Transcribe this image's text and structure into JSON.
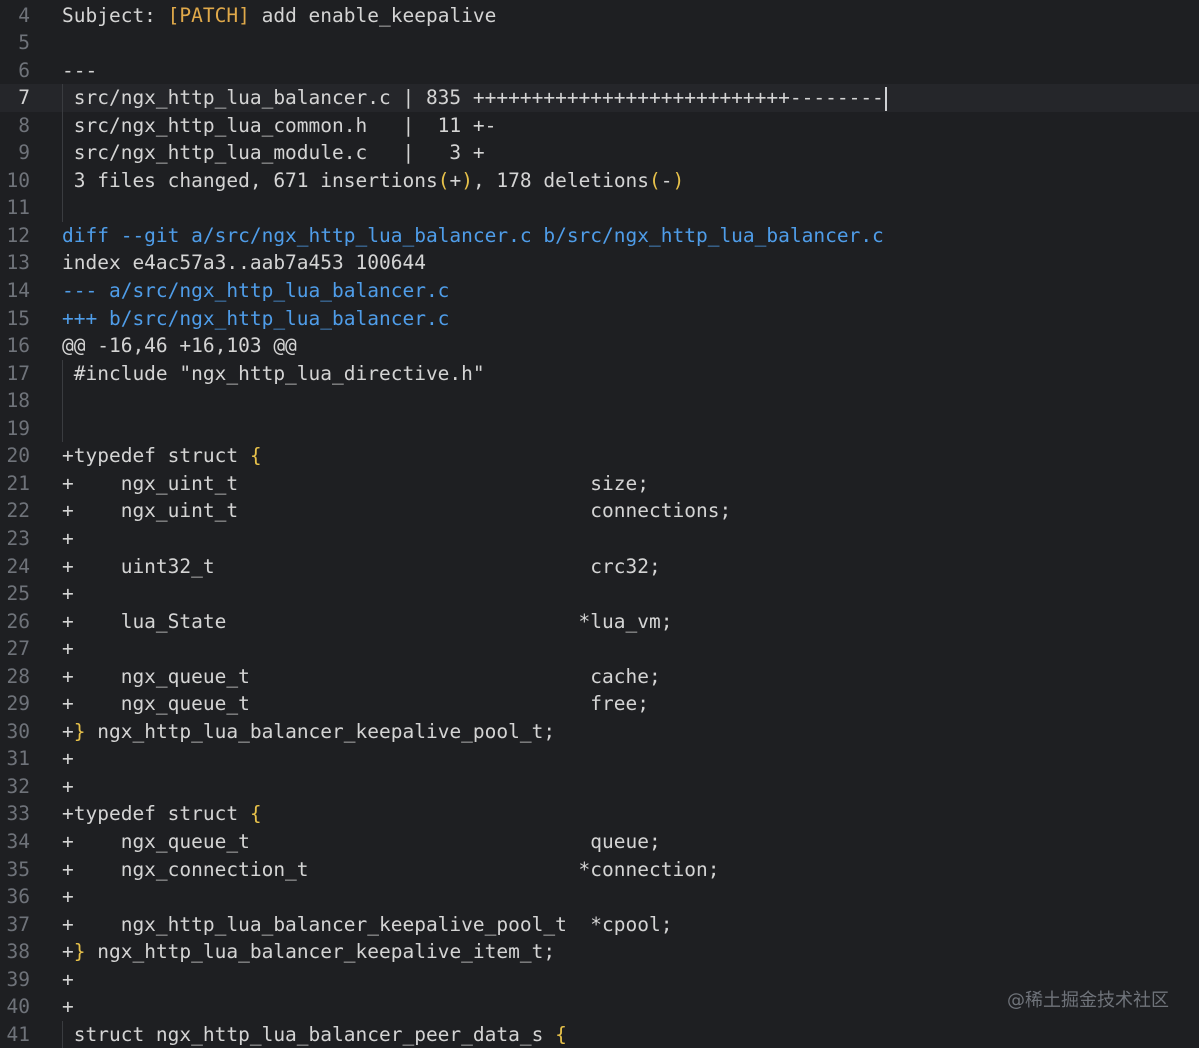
{
  "editor": {
    "lines": [
      {
        "num": "4",
        "segments": [
          {
            "text": "Subject: ",
            "cls": "subj"
          },
          {
            "text": "[PATCH]",
            "cls": "tag"
          },
          {
            "text": " add enable_keepalive",
            "cls": "subj"
          }
        ]
      },
      {
        "num": "5",
        "segments": []
      },
      {
        "num": "6",
        "segments": [
          {
            "text": "---",
            "cls": ""
          }
        ]
      },
      {
        "num": "7",
        "current": true,
        "guide": true,
        "segments": [
          {
            "text": " src/ngx_http_lua_balancer.c | 835 +++++++++++++++++++++++++++--------",
            "cls": ""
          }
        ],
        "caret": true
      },
      {
        "num": "8",
        "guide": true,
        "segments": [
          {
            "text": " src/ngx_http_lua_common.h   |  11 +-",
            "cls": ""
          }
        ]
      },
      {
        "num": "9",
        "guide": true,
        "segments": [
          {
            "text": " src/ngx_http_lua_module.c   |   3 +",
            "cls": ""
          }
        ]
      },
      {
        "num": "10",
        "guide": true,
        "segments": [
          {
            "text": " 3 files changed, 671 insertions",
            "cls": ""
          },
          {
            "text": "(",
            "cls": "yellow"
          },
          {
            "text": "+",
            "cls": ""
          },
          {
            "text": ")",
            "cls": "yellow"
          },
          {
            "text": ", 178 deletions",
            "cls": ""
          },
          {
            "text": "(",
            "cls": "yellow"
          },
          {
            "text": "-",
            "cls": ""
          },
          {
            "text": ")",
            "cls": "yellow"
          }
        ]
      },
      {
        "num": "11",
        "guide": true,
        "segments": []
      },
      {
        "num": "12",
        "segments": [
          {
            "text": "diff --git a/src/ngx_http_lua_balancer.c b/src/ngx_http_lua_balancer.c",
            "cls": "blue"
          }
        ]
      },
      {
        "num": "13",
        "segments": [
          {
            "text": "index e4ac57a3..aab7a453 100644",
            "cls": ""
          }
        ]
      },
      {
        "num": "14",
        "segments": [
          {
            "text": "--- a/src/ngx_http_lua_balancer.c",
            "cls": "blue"
          }
        ]
      },
      {
        "num": "15",
        "segments": [
          {
            "text": "+++ b/src/ngx_http_lua_balancer.c",
            "cls": "blue"
          }
        ]
      },
      {
        "num": "16",
        "segments": [
          {
            "text": "@@ -16,46 +16,103 @@",
            "cls": ""
          }
        ]
      },
      {
        "num": "17",
        "guide": true,
        "segments": [
          {
            "text": " #include \"ngx_http_lua_directive.h\"",
            "cls": ""
          }
        ]
      },
      {
        "num": "18",
        "guide": true,
        "segments": []
      },
      {
        "num": "19",
        "guide": true,
        "segments": []
      },
      {
        "num": "20",
        "segments": [
          {
            "text": "+typedef struct ",
            "cls": ""
          },
          {
            "text": "{",
            "cls": "yellow"
          }
        ]
      },
      {
        "num": "21",
        "segments": [
          {
            "text": "+    ngx_uint_t                              size;",
            "cls": ""
          }
        ]
      },
      {
        "num": "22",
        "segments": [
          {
            "text": "+    ngx_uint_t                              connections;",
            "cls": ""
          }
        ]
      },
      {
        "num": "23",
        "segments": [
          {
            "text": "+",
            "cls": ""
          }
        ]
      },
      {
        "num": "24",
        "segments": [
          {
            "text": "+    uint32_t                                crc32;",
            "cls": ""
          }
        ]
      },
      {
        "num": "25",
        "segments": [
          {
            "text": "+",
            "cls": ""
          }
        ]
      },
      {
        "num": "26",
        "segments": [
          {
            "text": "+    lua_State                              *lua_vm;",
            "cls": ""
          }
        ]
      },
      {
        "num": "27",
        "segments": [
          {
            "text": "+",
            "cls": ""
          }
        ]
      },
      {
        "num": "28",
        "segments": [
          {
            "text": "+    ngx_queue_t                             cache;",
            "cls": ""
          }
        ]
      },
      {
        "num": "29",
        "segments": [
          {
            "text": "+    ngx_queue_t                             free;",
            "cls": ""
          }
        ]
      },
      {
        "num": "30",
        "segments": [
          {
            "text": "+",
            "cls": ""
          },
          {
            "text": "}",
            "cls": "yellow"
          },
          {
            "text": " ngx_http_lua_balancer_keepalive_pool_t;",
            "cls": ""
          }
        ]
      },
      {
        "num": "31",
        "segments": [
          {
            "text": "+",
            "cls": ""
          }
        ]
      },
      {
        "num": "32",
        "segments": [
          {
            "text": "+",
            "cls": ""
          }
        ]
      },
      {
        "num": "33",
        "segments": [
          {
            "text": "+typedef struct ",
            "cls": ""
          },
          {
            "text": "{",
            "cls": "yellow"
          }
        ]
      },
      {
        "num": "34",
        "segments": [
          {
            "text": "+    ngx_queue_t                             queue;",
            "cls": ""
          }
        ]
      },
      {
        "num": "35",
        "segments": [
          {
            "text": "+    ngx_connection_t                       *connection;",
            "cls": ""
          }
        ]
      },
      {
        "num": "36",
        "segments": [
          {
            "text": "+",
            "cls": ""
          }
        ]
      },
      {
        "num": "37",
        "segments": [
          {
            "text": "+    ngx_http_lua_balancer_keepalive_pool_t  *cpool;",
            "cls": ""
          }
        ]
      },
      {
        "num": "38",
        "segments": [
          {
            "text": "+",
            "cls": ""
          },
          {
            "text": "}",
            "cls": "yellow"
          },
          {
            "text": " ngx_http_lua_balancer_keepalive_item_t;",
            "cls": ""
          }
        ]
      },
      {
        "num": "39",
        "segments": [
          {
            "text": "+",
            "cls": ""
          }
        ]
      },
      {
        "num": "40",
        "segments": [
          {
            "text": "+",
            "cls": ""
          }
        ]
      },
      {
        "num": "41",
        "guide": true,
        "segments": [
          {
            "text": " struct ngx_http_lua_balancer_peer_data_s ",
            "cls": ""
          },
          {
            "text": "{",
            "cls": "yellow"
          }
        ]
      }
    ]
  },
  "watermark": "@稀土掘金技术社区"
}
